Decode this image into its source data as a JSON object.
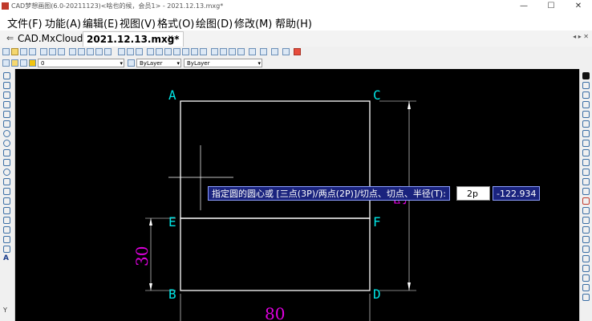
{
  "window": {
    "title": "CAD梦想画图(6.0-20211123)<啥也的候，会员1> - 2021.12.13.mxg*",
    "min": "—",
    "max": "☐",
    "close": "✕"
  },
  "menu": {
    "items": [
      "文件(F)",
      "功能(A)",
      "编辑(E)",
      "视图(V)",
      "格式(O)",
      "绘图(D)",
      "修改(M)",
      "帮助(H)"
    ]
  },
  "tabs": {
    "items": [
      "CAD.MxCloud",
      "2021.12.13.mxg*"
    ],
    "controls": "◂ ▸ ✕"
  },
  "propbar": {
    "layer": "0",
    "color": "ByLayer",
    "linetype": "ByLayer"
  },
  "drawing": {
    "labels": {
      "A": "A",
      "C": "C",
      "E": "E",
      "F": "F",
      "B": "B",
      "D": "D"
    },
    "dim_height": "30",
    "dim_width": "80",
    "dim_right": "50"
  },
  "command": {
    "prompt": "指定圆的圆心或 [三点(3P)/两点(2P)]/切点、切点、半径(T):",
    "input": "2p",
    "coord": "-122.934"
  },
  "colors": {
    "canvas": "#000000",
    "geometry": "#ffffff",
    "labels": "#00e5e5",
    "dimension": "#e000e0",
    "prompt_bg": "#1a237e"
  }
}
